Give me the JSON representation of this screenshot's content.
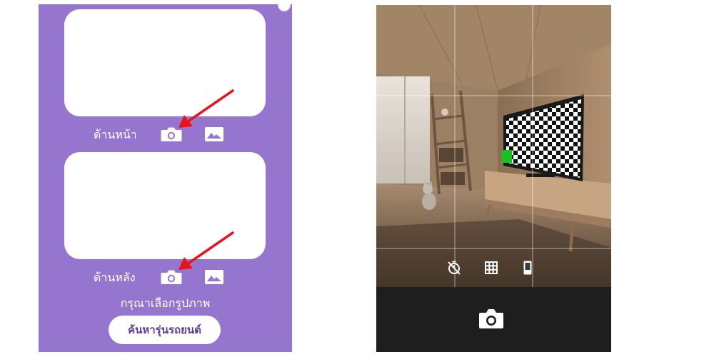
{
  "upload_form": {
    "front": {
      "label": "ด้านหน้า"
    },
    "back": {
      "label": "ด้านหลัง"
    },
    "hint": "กรุณาเลือกรูปภาพ",
    "search_button": "ค้นหารุ่นรถยนต์"
  },
  "camera": {
    "tools": [
      "timer-off-icon",
      "grid-icon",
      "aspect-ratio-icon"
    ],
    "shutter_icon": "camera-icon"
  },
  "colors": {
    "panel_purple": "#9575cd",
    "annotation_arrow": "#e8141c",
    "camera_bar": "#1e1e1e"
  }
}
